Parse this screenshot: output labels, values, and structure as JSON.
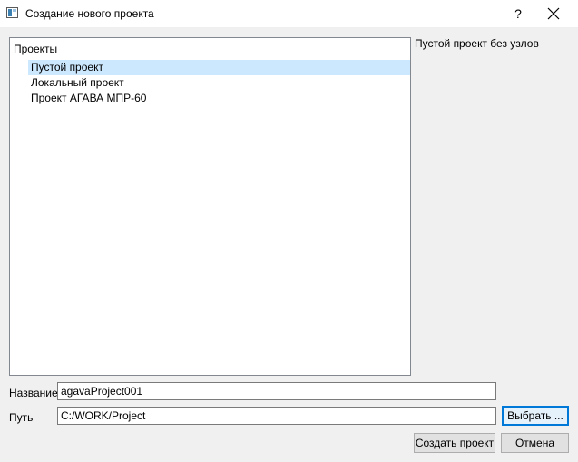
{
  "window": {
    "title": "Создание нового проекта",
    "help_label": "?"
  },
  "tree": {
    "header": "Проекты",
    "items": [
      {
        "label": "Пустой проект",
        "selected": true
      },
      {
        "label": "Локальный проект",
        "selected": false
      },
      {
        "label": "Проект АГАВА МПР-60",
        "selected": false
      }
    ]
  },
  "description": "Пустой проект без узлов",
  "form": {
    "name_label": "Название",
    "name_value": "agavaProject001",
    "path_label": "Путь",
    "path_value": "C:/WORK/Project",
    "browse_label": "Выбрать ..."
  },
  "buttons": {
    "create_label": "Создать проект",
    "cancel_label": "Отмена"
  },
  "colors": {
    "selection": "#cce8ff",
    "focus_border": "#0078d7",
    "dialog_background": "#f0f0f0"
  }
}
